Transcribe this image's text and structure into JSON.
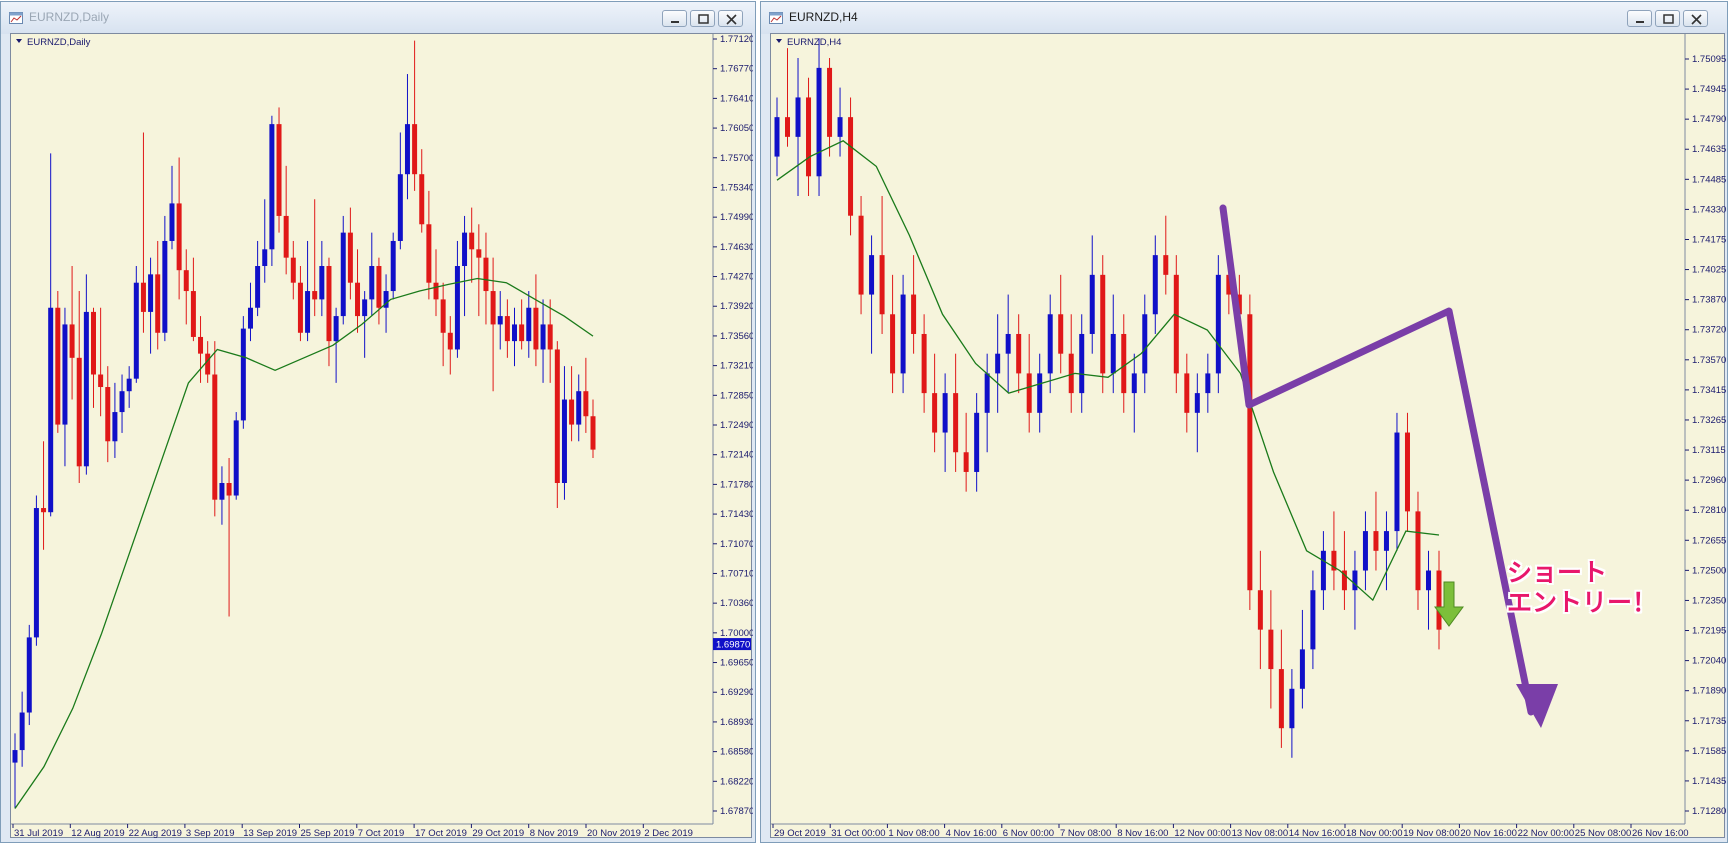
{
  "windows": [
    {
      "title": "EURNZD,Daily",
      "symbol_label": "EURNZD,Daily",
      "y_ticks": [
        "1.77120",
        "1.76770",
        "1.76410",
        "1.76050",
        "1.75700",
        "1.75340",
        "1.74990",
        "1.74630",
        "1.74270",
        "1.73920",
        "1.73560",
        "1.73210",
        "1.72850",
        "1.72490",
        "1.72140",
        "1.71780",
        "1.71430",
        "1.71070",
        "1.70710",
        "1.70360",
        "1.70000",
        "1.69650",
        "1.69290",
        "1.68930",
        "1.68580",
        "1.68220",
        "1.67870"
      ],
      "x_ticks": [
        "31 Jul 2019",
        "12 Aug 2019",
        "22 Aug 2019",
        "3 Sep 2019",
        "13 Sep 2019",
        "25 Sep 2019",
        "7 Oct 2019",
        "17 Oct 2019",
        "29 Oct 2019",
        "8 Nov 2019",
        "20 Nov 2019",
        "2 Dec 2019"
      ],
      "current_price": "1.69870"
    },
    {
      "title": "EURNZD,H4",
      "symbol_label": "EURNZD,H4",
      "y_ticks": [
        "1.75095",
        "1.74945",
        "1.74790",
        "1.74635",
        "1.74485",
        "1.74330",
        "1.74175",
        "1.74025",
        "1.73870",
        "1.73720",
        "1.73570",
        "1.73415",
        "1.73265",
        "1.73115",
        "1.72960",
        "1.72810",
        "1.72655",
        "1.72500",
        "1.72350",
        "1.72195",
        "1.72040",
        "1.71890",
        "1.71735",
        "1.71585",
        "1.71435",
        "1.71280"
      ],
      "x_ticks": [
        "29 Oct 2019",
        "31 Oct 00:00",
        "1 Nov 08:00",
        "4 Nov 16:00",
        "6 Nov 00:00",
        "7 Nov 08:00",
        "8 Nov 16:00",
        "12 Nov 00:00",
        "13 Nov 08:00",
        "14 Nov 16:00",
        "18 Nov 00:00",
        "19 Nov 08:00",
        "20 Nov 16:00",
        "22 Nov 00:00",
        "25 Nov 08:00",
        "26 Nov 16:00"
      ]
    }
  ],
  "annotation": "ショート\nエントリー！",
  "colors": {
    "chart_bg": "#f6f4dc",
    "bull": "#1010c8",
    "bear": "#e01818",
    "ma": "#1a7a1a",
    "axis_text": "#1a1a6e",
    "annotation_text": "#e8176b",
    "drawing": "#7a3ea8",
    "entry_arrow": "#7cbf3a",
    "current_price_bg": "#1010c8"
  },
  "chart_data": [
    {
      "type": "candlestick",
      "symbol": "EURNZD",
      "timeframe": "Daily",
      "ylim": [
        1.6787,
        1.7712
      ],
      "ohlc": [
        [
          1.6845,
          1.688,
          1.679,
          1.686
        ],
        [
          1.686,
          1.693,
          1.684,
          1.6905
        ],
        [
          1.6905,
          1.701,
          1.689,
          1.6995
        ],
        [
          1.6995,
          1.7165,
          1.6985,
          1.715
        ],
        [
          1.715,
          1.723,
          1.71,
          1.7145
        ],
        [
          1.7145,
          1.7575,
          1.714,
          1.739
        ],
        [
          1.739,
          1.741,
          1.724,
          1.725
        ],
        [
          1.725,
          1.739,
          1.72,
          1.737
        ],
        [
          1.737,
          1.744,
          1.728,
          1.733
        ],
        [
          1.733,
          1.741,
          1.718,
          1.72
        ],
        [
          1.72,
          1.743,
          1.719,
          1.7385
        ],
        [
          1.7385,
          1.739,
          1.727,
          1.731
        ],
        [
          1.731,
          1.739,
          1.726,
          1.7295
        ],
        [
          1.7295,
          1.732,
          1.7205,
          1.723
        ],
        [
          1.723,
          1.73,
          1.721,
          1.7265
        ],
        [
          1.7265,
          1.731,
          1.724,
          1.729
        ],
        [
          1.729,
          1.732,
          1.727,
          1.7305
        ],
        [
          1.7305,
          1.744,
          1.73,
          1.742
        ],
        [
          1.742,
          1.76,
          1.736,
          1.7385
        ],
        [
          1.7385,
          1.745,
          1.7335,
          1.743
        ],
        [
          1.743,
          1.747,
          1.734,
          1.736
        ],
        [
          1.736,
          1.75,
          1.735,
          1.747
        ],
        [
          1.747,
          1.756,
          1.746,
          1.7515
        ],
        [
          1.7515,
          1.757,
          1.74,
          1.7435
        ],
        [
          1.7435,
          1.746,
          1.737,
          1.741
        ],
        [
          1.741,
          1.745,
          1.735,
          1.7355
        ],
        [
          1.7355,
          1.738,
          1.73,
          1.7335
        ],
        [
          1.7335,
          1.735,
          1.73,
          1.731
        ],
        [
          1.731,
          1.735,
          1.714,
          1.716
        ],
        [
          1.716,
          1.72,
          1.713,
          1.718
        ],
        [
          1.718,
          1.721,
          1.702,
          1.7165
        ],
        [
          1.7165,
          1.7265,
          1.716,
          1.7255
        ],
        [
          1.7255,
          1.738,
          1.7245,
          1.7365
        ],
        [
          1.7365,
          1.742,
          1.735,
          1.739
        ],
        [
          1.739,
          1.747,
          1.738,
          1.744
        ],
        [
          1.744,
          1.752,
          1.742,
          1.746
        ],
        [
          1.746,
          1.762,
          1.744,
          1.761
        ],
        [
          1.761,
          1.763,
          1.748,
          1.75
        ],
        [
          1.75,
          1.756,
          1.743,
          1.745
        ],
        [
          1.745,
          1.747,
          1.74,
          1.742
        ],
        [
          1.742,
          1.744,
          1.735,
          1.736
        ],
        [
          1.736,
          1.747,
          1.735,
          1.741
        ],
        [
          1.741,
          1.752,
          1.738,
          1.74
        ],
        [
          1.74,
          1.747,
          1.738,
          1.744
        ],
        [
          1.744,
          1.745,
          1.732,
          1.735
        ],
        [
          1.735,
          1.739,
          1.73,
          1.738
        ],
        [
          1.738,
          1.75,
          1.737,
          1.748
        ],
        [
          1.748,
          1.751,
          1.74,
          1.742
        ],
        [
          1.742,
          1.746,
          1.736,
          1.738
        ],
        [
          1.738,
          1.741,
          1.733,
          1.74
        ],
        [
          1.74,
          1.748,
          1.738,
          1.744
        ],
        [
          1.744,
          1.745,
          1.737,
          1.739
        ],
        [
          1.739,
          1.743,
          1.736,
          1.741
        ],
        [
          1.741,
          1.748,
          1.74,
          1.747
        ],
        [
          1.747,
          1.76,
          1.746,
          1.755
        ],
        [
          1.755,
          1.767,
          1.752,
          1.761
        ],
        [
          1.761,
          1.771,
          1.753,
          1.755
        ],
        [
          1.755,
          1.758,
          1.748,
          1.749
        ],
        [
          1.749,
          1.753,
          1.74,
          1.742
        ],
        [
          1.742,
          1.746,
          1.738,
          1.74
        ],
        [
          1.74,
          1.742,
          1.732,
          1.736
        ],
        [
          1.736,
          1.738,
          1.731,
          1.734
        ],
        [
          1.734,
          1.747,
          1.733,
          1.744
        ],
        [
          1.744,
          1.75,
          1.738,
          1.748
        ],
        [
          1.748,
          1.751,
          1.742,
          1.746
        ],
        [
          1.746,
          1.749,
          1.738,
          1.745
        ],
        [
          1.745,
          1.748,
          1.737,
          1.741
        ],
        [
          1.741,
          1.745,
          1.729,
          1.737
        ],
        [
          1.737,
          1.741,
          1.734,
          1.738
        ],
        [
          1.738,
          1.74,
          1.733,
          1.735
        ],
        [
          1.735,
          1.739,
          1.732,
          1.737
        ],
        [
          1.737,
          1.74,
          1.734,
          1.735
        ],
        [
          1.735,
          1.741,
          1.733,
          1.739
        ],
        [
          1.739,
          1.743,
          1.732,
          1.734
        ],
        [
          1.734,
          1.74,
          1.73,
          1.737
        ],
        [
          1.737,
          1.74,
          1.73,
          1.734
        ],
        [
          1.734,
          1.735,
          1.715,
          1.718
        ],
        [
          1.718,
          1.732,
          1.716,
          1.728
        ],
        [
          1.728,
          1.732,
          1.723,
          1.725
        ],
        [
          1.725,
          1.731,
          1.723,
          1.729
        ],
        [
          1.729,
          1.733,
          1.724,
          1.726
        ],
        [
          1.726,
          1.728,
          1.721,
          1.722
        ]
      ],
      "moving_average": [
        1.679,
        1.684,
        1.691,
        1.7,
        1.71,
        1.72,
        1.73,
        1.734,
        1.733,
        1.7315,
        1.733,
        1.7345,
        1.737,
        1.74,
        1.741,
        1.7418,
        1.7425,
        1.742,
        1.74,
        1.738,
        1.7356
      ],
      "x": [
        "31 Jul 2019",
        "12 Aug 2019",
        "22 Aug 2019",
        "3 Sep 2019",
        "13 Sep 2019",
        "25 Sep 2019",
        "7 Oct 2019",
        "17 Oct 2019",
        "29 Oct 2019",
        "8 Nov 2019",
        "20 Nov 2019",
        "2 Dec 2019"
      ],
      "current_price": 1.6987
    },
    {
      "type": "candlestick",
      "symbol": "EURNZD",
      "timeframe": "H4",
      "ylim": [
        1.7128,
        1.75095
      ],
      "ohlc": [
        [
          1.746,
          1.749,
          1.745,
          1.748
        ],
        [
          1.748,
          1.7515,
          1.7465,
          1.747
        ],
        [
          1.747,
          1.751,
          1.744,
          1.749
        ],
        [
          1.749,
          1.75,
          1.744,
          1.745
        ],
        [
          1.745,
          1.752,
          1.744,
          1.7505
        ],
        [
          1.7505,
          1.751,
          1.746,
          1.747
        ],
        [
          1.747,
          1.7495,
          1.746,
          1.748
        ],
        [
          1.748,
          1.749,
          1.742,
          1.743
        ],
        [
          1.743,
          1.744,
          1.738,
          1.739
        ],
        [
          1.739,
          1.742,
          1.736,
          1.741
        ],
        [
          1.741,
          1.744,
          1.737,
          1.738
        ],
        [
          1.738,
          1.74,
          1.734,
          1.735
        ],
        [
          1.735,
          1.74,
          1.734,
          1.739
        ],
        [
          1.739,
          1.741,
          1.736,
          1.737
        ],
        [
          1.737,
          1.738,
          1.733,
          1.734
        ],
        [
          1.734,
          1.736,
          1.731,
          1.732
        ],
        [
          1.732,
          1.735,
          1.73,
          1.734
        ],
        [
          1.734,
          1.736,
          1.73,
          1.731
        ],
        [
          1.731,
          1.733,
          1.729,
          1.73
        ],
        [
          1.73,
          1.734,
          1.729,
          1.733
        ],
        [
          1.733,
          1.736,
          1.731,
          1.735
        ],
        [
          1.735,
          1.738,
          1.733,
          1.736
        ],
        [
          1.736,
          1.739,
          1.734,
          1.737
        ],
        [
          1.737,
          1.738,
          1.734,
          1.735
        ],
        [
          1.735,
          1.737,
          1.732,
          1.733
        ],
        [
          1.733,
          1.736,
          1.732,
          1.735
        ],
        [
          1.735,
          1.739,
          1.734,
          1.738
        ],
        [
          1.738,
          1.74,
          1.735,
          1.736
        ],
        [
          1.736,
          1.738,
          1.733,
          1.734
        ],
        [
          1.734,
          1.738,
          1.733,
          1.737
        ],
        [
          1.737,
          1.742,
          1.736,
          1.74
        ],
        [
          1.74,
          1.741,
          1.734,
          1.735
        ],
        [
          1.735,
          1.739,
          1.734,
          1.737
        ],
        [
          1.737,
          1.738,
          1.733,
          1.734
        ],
        [
          1.734,
          1.736,
          1.732,
          1.735
        ],
        [
          1.735,
          1.739,
          1.734,
          1.738
        ],
        [
          1.738,
          1.742,
          1.737,
          1.741
        ],
        [
          1.741,
          1.743,
          1.739,
          1.74
        ],
        [
          1.74,
          1.741,
          1.734,
          1.735
        ],
        [
          1.735,
          1.736,
          1.732,
          1.733
        ],
        [
          1.733,
          1.735,
          1.731,
          1.734
        ],
        [
          1.734,
          1.736,
          1.733,
          1.735
        ],
        [
          1.735,
          1.741,
          1.734,
          1.74
        ],
        [
          1.74,
          1.742,
          1.738,
          1.739
        ],
        [
          1.739,
          1.74,
          1.736,
          1.738
        ],
        [
          1.738,
          1.739,
          1.723,
          1.724
        ],
        [
          1.724,
          1.726,
          1.72,
          1.722
        ],
        [
          1.722,
          1.724,
          1.718,
          1.72
        ],
        [
          1.72,
          1.722,
          1.716,
          1.717
        ],
        [
          1.717,
          1.72,
          1.7155,
          1.719
        ],
        [
          1.719,
          1.723,
          1.718,
          1.721
        ],
        [
          1.721,
          1.725,
          1.72,
          1.724
        ],
        [
          1.724,
          1.727,
          1.723,
          1.726
        ],
        [
          1.726,
          1.728,
          1.724,
          1.725
        ],
        [
          1.725,
          1.727,
          1.723,
          1.724
        ],
        [
          1.724,
          1.726,
          1.722,
          1.725
        ],
        [
          1.725,
          1.728,
          1.724,
          1.727
        ],
        [
          1.727,
          1.729,
          1.725,
          1.726
        ],
        [
          1.726,
          1.728,
          1.724,
          1.727
        ],
        [
          1.727,
          1.733,
          1.726,
          1.732
        ],
        [
          1.732,
          1.733,
          1.727,
          1.728
        ],
        [
          1.728,
          1.729,
          1.723,
          1.724
        ],
        [
          1.724,
          1.726,
          1.722,
          1.725
        ],
        [
          1.725,
          1.726,
          1.721,
          1.722
        ]
      ],
      "moving_average": [
        1.7448,
        1.746,
        1.7468,
        1.7455,
        1.742,
        1.738,
        1.7355,
        1.734,
        1.7345,
        1.735,
        1.7348,
        1.736,
        1.738,
        1.7372,
        1.735,
        1.73,
        1.726,
        1.725,
        1.7235,
        1.727,
        1.7268
      ],
      "x": [
        "29 Oct 2019",
        "31 Oct 00:00",
        "1 Nov 08:00",
        "4 Nov 16:00",
        "6 Nov 00:00",
        "7 Nov 08:00",
        "8 Nov 16:00",
        "12 Nov 00:00",
        "13 Nov 08:00",
        "14 Nov 16:00",
        "18 Nov 00:00",
        "19 Nov 08:00",
        "20 Nov 16:00",
        "22 Nov 00:00",
        "25 Nov 08:00",
        "26 Nov 16:00"
      ]
    }
  ]
}
